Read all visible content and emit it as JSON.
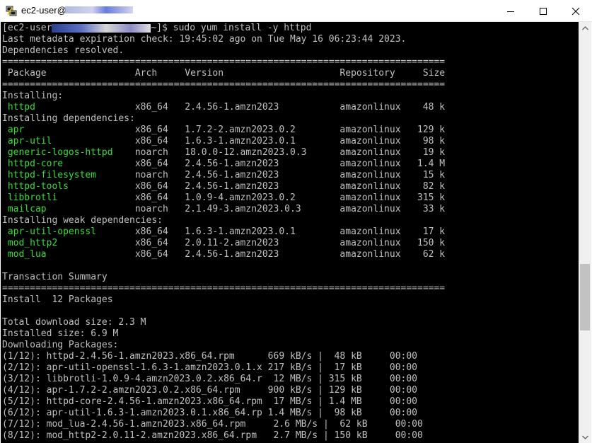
{
  "window": {
    "title": "ec2-user@",
    "icons": {
      "app": "putty-icon",
      "minimize": "minimize-icon",
      "maximize": "maximize-icon",
      "close": "close-icon",
      "scroll_up": "arrow-up-icon",
      "scroll_down": "arrow-down-icon"
    }
  },
  "terminal": {
    "prompt_prefix": "[ec2-user",
    "prompt_suffix": "~]$ ",
    "command": "sudo yum install -y httpd",
    "metadata_line": "Last metadata expiration check: 19:45:02 ago on Tue May 16 06:23:44 2023.",
    "resolved_line": "Dependencies resolved.",
    "rule_double": "================================================================================",
    "table_header": " Package                Arch     Version                     Repository     Size",
    "section_installing": "Installing:",
    "installing": [
      {
        "name": " httpd                 ",
        "rest": " x86_64   2.4.56-1.amzn2023           amazonlinux    48 k"
      }
    ],
    "section_deps": "Installing dependencies:",
    "deps": [
      {
        "name": " apr                   ",
        "rest": " x86_64   1.7.2-2.amzn2023.0.2        amazonlinux   129 k"
      },
      {
        "name": " apr-util              ",
        "rest": " x86_64   1.6.3-1.amzn2023.0.1        amazonlinux    98 k"
      },
      {
        "name": " generic-logos-httpd   ",
        "rest": " noarch   18.0.0-12.amzn2023.0.3      amazonlinux    19 k"
      },
      {
        "name": " httpd-core            ",
        "rest": " x86_64   2.4.56-1.amzn2023           amazonlinux   1.4 M"
      },
      {
        "name": " httpd-filesystem      ",
        "rest": " noarch   2.4.56-1.amzn2023           amazonlinux    15 k"
      },
      {
        "name": " httpd-tools           ",
        "rest": " x86_64   2.4.56-1.amzn2023           amazonlinux    82 k"
      },
      {
        "name": " libbrotli             ",
        "rest": " x86_64   1.0.9-4.amzn2023.0.2        amazonlinux   315 k"
      },
      {
        "name": " mailcap               ",
        "rest": " noarch   2.1.49-3.amzn2023.0.3       amazonlinux    33 k"
      }
    ],
    "section_weak": "Installing weak dependencies:",
    "weak": [
      {
        "name": " apr-util-openssl      ",
        "rest": " x86_64   1.6.3-1.amzn2023.0.1        amazonlinux    17 k"
      },
      {
        "name": " mod_http2             ",
        "rest": " x86_64   2.0.11-2.amzn2023           amazonlinux   150 k"
      },
      {
        "name": " mod_lua               ",
        "rest": " x86_64   2.4.56-1.amzn2023           amazonlinux    62 k"
      }
    ],
    "summary_title": "Transaction Summary",
    "install_count": "Install  12 Packages",
    "total_download": "Total download size: 2.3 M",
    "installed_size": "Installed size: 6.9 M",
    "downloading": "Downloading Packages:",
    "downloads": [
      "(1/12): httpd-2.4.56-1.amzn2023.x86_64.rpm      669 kB/s |  48 kB     00:00",
      "(2/12): apr-util-openssl-1.6.3-1.amzn2023.0.1.x 217 kB/s |  17 kB     00:00",
      "(3/12): libbrotli-1.0.9-4.amzn2023.0.2.x86_64.r  12 MB/s | 315 kB     00:00",
      "(4/12): apr-1.7.2-2.amzn2023.0.2.x86_64.rpm     900 kB/s | 129 kB     00:00",
      "(5/12): httpd-core-2.4.56-1.amzn2023.x86_64.rpm  17 MB/s | 1.4 MB     00:00",
      "(6/12): apr-util-1.6.3-1.amzn2023.0.1.x86_64.rp 1.4 MB/s |  98 kB     00:00",
      "(7/12): mod_lua-2.4.56-1.amzn2023.x86_64.rpm     2.6 MB/s |  62 kB     00:00",
      "(8/12): mod_http2-2.0.11-2.amzn2023.x86_64.rpm   2.7 MB/s | 150 kB     00:00"
    ]
  },
  "colors": {
    "terminal_bg": "#000000",
    "terminal_text": "#c0c0c0",
    "package_name": "#2ee02e"
  }
}
